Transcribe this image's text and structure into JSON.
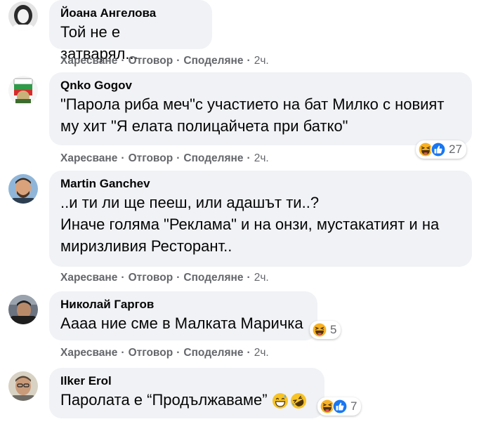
{
  "actions": {
    "like": "Харесване",
    "reply": "Отговор",
    "share": "Споделяне",
    "separator": "·"
  },
  "comments": [
    {
      "author": "Йоана Ангелова",
      "text": "Той не е затварял...",
      "time": "2ч.",
      "avatar": "profile-photo-woman"
    },
    {
      "author": "Qnko Gogov",
      "text": "\"Парола риба меч\"с участието на бат Милко с новият\nму хит \"Я елата полицайчета при батко\"",
      "time": "2ч.",
      "avatar": "profile-photo-badge",
      "reactions": {
        "icons": [
          "haha-icon",
          "like-icon"
        ],
        "count": "27"
      }
    },
    {
      "author": "Martin Ganchev",
      "text": "..и ти ли ще пееш, или адашът ти..?\nИначе голяма \"Реклама\" и на онзи, мустакатият и на\nмиризливия Ресторант..",
      "time": "2ч.",
      "avatar": "profile-photo-man-beard"
    },
    {
      "author": "Николай Гаргов",
      "text": "Аааа ние сме в Малката Маричка",
      "time": "2ч.",
      "avatar": "profile-photo-man-dark",
      "reactions": {
        "icons": [
          "haha-icon"
        ],
        "count": "5"
      }
    },
    {
      "author": "Ilker Erol",
      "text": "Паролата е “Продължаваме”",
      "avatar": "profile-photo-man-glasses",
      "inline_emoji": [
        "grinning-sweat-emoji",
        "rolling-laughing-emoji"
      ],
      "reactions": {
        "icons": [
          "haha-icon",
          "like-icon"
        ],
        "count": "7"
      }
    }
  ],
  "colors": {
    "bubble": "#f0f2f5",
    "meta_text": "#65676b",
    "like_blue": "#1877f2",
    "haha_yellow": "#f7b125"
  }
}
